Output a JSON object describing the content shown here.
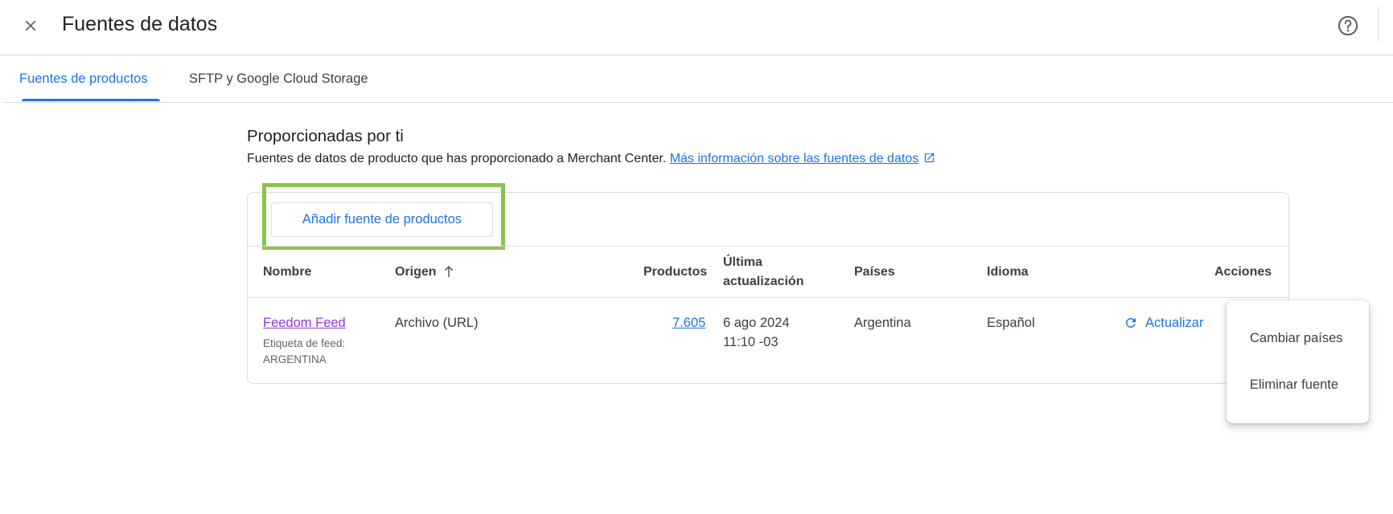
{
  "header": {
    "title": "Fuentes de datos",
    "close_icon": "close-icon",
    "help_icon": "help-icon"
  },
  "tabs": [
    {
      "label": "Fuentes de productos",
      "active": true
    },
    {
      "label": "SFTP y Google Cloud Storage",
      "active": false
    }
  ],
  "section": {
    "title": "Proporcionadas por ti",
    "description": "Fuentes de datos de producto que has proporcionado a Merchant Center.",
    "link_text": "Más información sobre las fuentes de datos"
  },
  "toolbar": {
    "add_button_label": "Añadir fuente de productos"
  },
  "table": {
    "columns": {
      "name": "Nombre",
      "origin": "Origen",
      "products": "Productos",
      "last_update_line1": "Última",
      "last_update_line2": "actualización",
      "countries": "Países",
      "language": "Idioma",
      "actions": "Acciones"
    },
    "rows": [
      {
        "name": "Feedom Feed",
        "label_caption": "Etiqueta de feed:",
        "label_value": "ARGENTINA",
        "origin": "Archivo (URL)",
        "products": "7.605",
        "date": "6 ago 2024",
        "time": "11:10 -03",
        "country": "Argentina",
        "language": "Español",
        "action_label": "Actualizar"
      }
    ]
  },
  "menu": {
    "items": [
      "Cambiar países",
      "Eliminar fuente"
    ]
  },
  "colors": {
    "accent": "#1a73e8",
    "visited_link": "#9334e6",
    "highlight": "#8bc34a"
  }
}
